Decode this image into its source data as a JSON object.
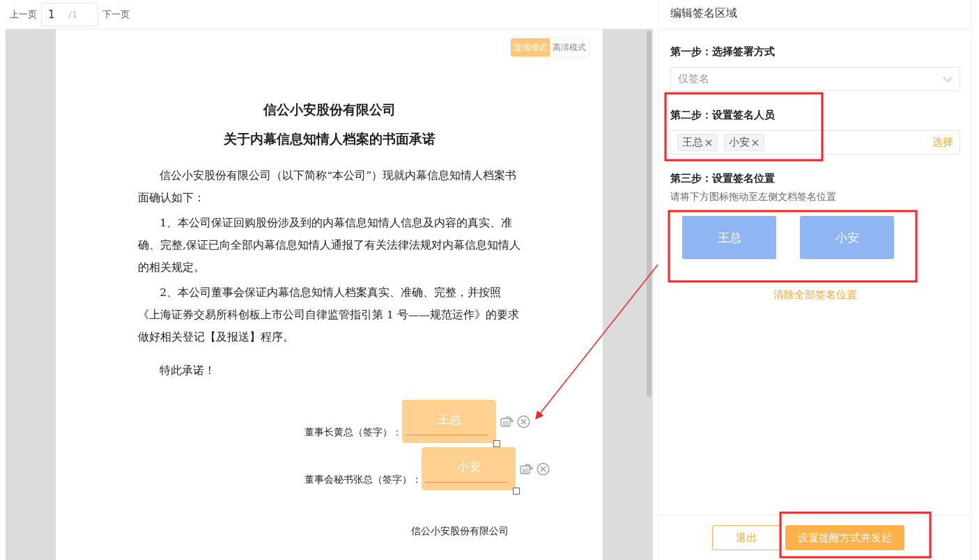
{
  "pager": {
    "prev": "上一页",
    "page": "1",
    "total": "/1",
    "next": "下一页"
  },
  "mode_toggle": [
    {
      "label": "普清模式",
      "selected": true
    },
    {
      "label": "高清模式",
      "selected": false
    }
  ],
  "document": {
    "titles": [
      "信公小安股份有限公司",
      "关于内幕信息知情人档案的书面承诺"
    ],
    "paragraphs": [
      "信公小安股份有限公司（以下简称“本公司”）现就内幕信息知情人档案书面确认如下：",
      "1、本公司保证回购股份涉及到的内幕信息知情人信息及内容的真实、准确、完整,保证已向全部内幕信息知情人通报了有关法律法规对内幕信息知情人的相关规定。",
      "2、本公司董事会保证内幕信息知情人档案真实、准确、完整，并按照《上海证券交易所科创板上市公司自律监管指引第 1 号——规范运作》的要求做好相关登记【及报送】程序。",
      "特此承诺！"
    ],
    "sign_rows": [
      {
        "label": "董事长黄总（签字）：",
        "stamp": "王总"
      },
      {
        "label": "董事会秘书张总（签字）：",
        "stamp": "小安"
      }
    ],
    "footer": "信公小安股份有限公司"
  },
  "panel": {
    "title": "编辑签名区域",
    "step1": {
      "heading": "第一步：选择签署方式",
      "value": "仅签名"
    },
    "step2": {
      "heading": "第二步：设置签名人员",
      "tags": [
        "王总",
        "小安"
      ],
      "action": "选择"
    },
    "step3": {
      "heading": "第三步：设置签名位置",
      "hint": "请将下方图标拖动至左侧文档签名位置",
      "signers": [
        "王总",
        "小安"
      ],
      "clear": "清除全部签名位置"
    },
    "buttons": [
      {
        "label": "退出",
        "kind": "secondary"
      },
      {
        "label": "设置提醒方式并发起",
        "kind": "primary"
      }
    ]
  }
}
